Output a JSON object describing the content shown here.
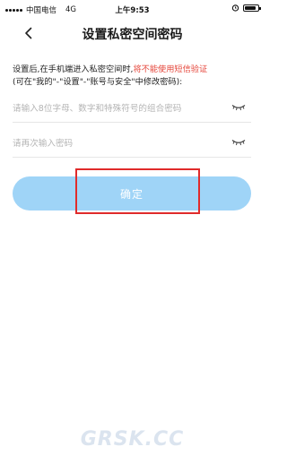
{
  "status_bar": {
    "carrier": "中国电信",
    "network": "4G",
    "time": "上午9:53",
    "battery_level": 0.85
  },
  "nav": {
    "title": "设置私密空间密码",
    "back_icon": "chevron-left-icon"
  },
  "notice": {
    "text_prefix": "设置后,在手机端进入私密空间时,",
    "text_warning": "将不能使用短信验证",
    "text_suffix": "(可在\"我的\"-\"设置\"-\"账号与安全\"中修改密码):",
    "warning_color": "#e5453a"
  },
  "form": {
    "password_placeholder": "请输入8位字母、数字和特殊符号的组合密码",
    "password_value": "",
    "confirm_placeholder": "请再次输入密码",
    "confirm_value": "",
    "eye_icon": "eye-closed-icon"
  },
  "confirm_button": {
    "label": "确定",
    "color": "#9fd4f7"
  },
  "watermark": {
    "text": "GRSK.CC"
  }
}
